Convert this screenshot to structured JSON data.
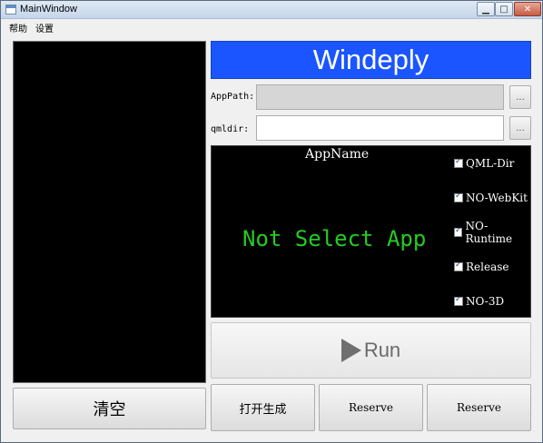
{
  "window": {
    "title": "MainWindow",
    "controls": {
      "minimize": "▁",
      "maximize": "□",
      "close": "✕"
    }
  },
  "menu": {
    "items": [
      "帮助",
      "设置"
    ]
  },
  "header": {
    "title": "Windeply"
  },
  "fields": {
    "app_path": {
      "label": "AppPath:",
      "value": "",
      "browse": "..."
    },
    "qml_dir": {
      "label": "qmldir:",
      "value": "",
      "browse": "..."
    }
  },
  "display": {
    "app_name": "AppName",
    "status": "Not Select App",
    "options": [
      {
        "label": "QML-Dir",
        "checked": true
      },
      {
        "label": "NO-WebKit",
        "checked": true
      },
      {
        "label": "NO-Runtime",
        "checked": true
      },
      {
        "label": "Release",
        "checked": true
      },
      {
        "label": "NO-3D",
        "checked": true
      }
    ]
  },
  "buttons": {
    "run": "Run",
    "clear": "清空",
    "open_generate": "打开生成",
    "reserve_1": "Reserve",
    "reserve_2": "Reserve"
  },
  "colors": {
    "header_bg": "#1a55ff",
    "status_text": "#22cc22",
    "panel_bg": "#000000"
  }
}
